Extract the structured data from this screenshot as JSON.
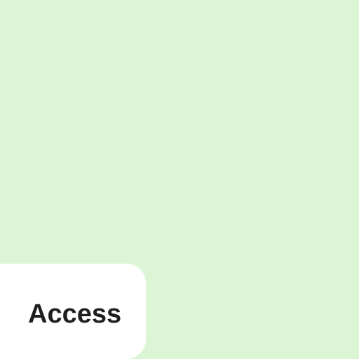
{
  "background": {
    "color": "#dcf5d4"
  },
  "card": {
    "label": "Access",
    "background_color": "#ffffff",
    "text_color": "#1f1f1f"
  }
}
